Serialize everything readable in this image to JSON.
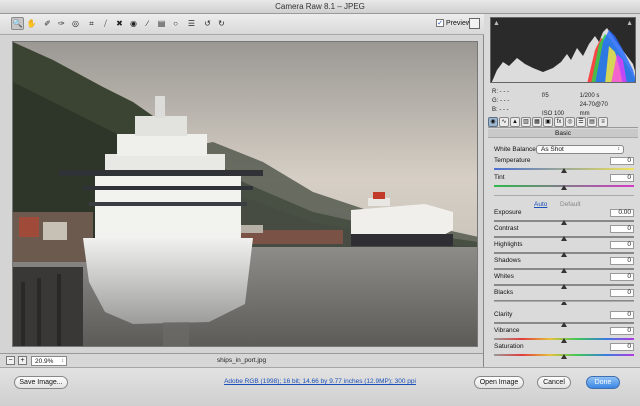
{
  "window": {
    "title": "Camera Raw 8.1  –  JPEG"
  },
  "toolbar": {
    "tools": [
      "zoom-icon",
      "hand-icon",
      "white-balance-icon",
      "color-sampler-icon",
      "target-adjust-icon",
      "crop-icon",
      "straighten-icon",
      "spot-removal-icon",
      "red-eye-icon",
      "adjustment-brush-icon",
      "graduated-filter-icon",
      "radial-filter-icon",
      "preferences-icon",
      "rotate-left-icon",
      "rotate-right-icon"
    ],
    "preview_label": "Preview",
    "preview_checked": true
  },
  "status": {
    "zoom_value": "20.9%",
    "filename": "ships_in_port.jpg"
  },
  "histogram": {
    "colors": [
      "#ff2a2a",
      "#28d04a",
      "#2a6cff",
      "#ffee33",
      "#ff33ff",
      "#33e6ff",
      "#ffffff"
    ]
  },
  "readout": {
    "r": "R:  - - -",
    "g": "G:  - - -",
    "b": "B:  - - -",
    "aperture": "f/5",
    "shutter": "1/200 s",
    "iso": "ISO 100",
    "focal": "24-70@70 mm"
  },
  "panel": {
    "title": "Basic",
    "white_balance_label": "White Balance:",
    "white_balance_value": "As Shot",
    "auto_label": "Auto",
    "default_label": "Default",
    "sliders": [
      {
        "label": "Temperature",
        "value": "0",
        "pos": 0.5
      },
      {
        "label": "Tint",
        "value": "0",
        "pos": 0.5
      },
      {
        "label": "Exposure",
        "value": "0.00",
        "pos": 0.5
      },
      {
        "label": "Contrast",
        "value": "0",
        "pos": 0.5
      },
      {
        "label": "Highlights",
        "value": "0",
        "pos": 0.5
      },
      {
        "label": "Shadows",
        "value": "0",
        "pos": 0.5
      },
      {
        "label": "Whites",
        "value": "0",
        "pos": 0.5
      },
      {
        "label": "Blacks",
        "value": "0",
        "pos": 0.5
      },
      {
        "label": "Clarity",
        "value": "0",
        "pos": 0.5
      },
      {
        "label": "Vibrance",
        "value": "0",
        "pos": 0.5
      },
      {
        "label": "Saturation",
        "value": "0",
        "pos": 0.5
      }
    ]
  },
  "bottom": {
    "save_label": "Save Image...",
    "workflow_link": "Adobe RGB (1998); 16 bit; 14.66 by 9.77 inches (12.9MP); 300 ppi",
    "open_label": "Open Image",
    "cancel_label": "Cancel",
    "done_label": "Done"
  }
}
